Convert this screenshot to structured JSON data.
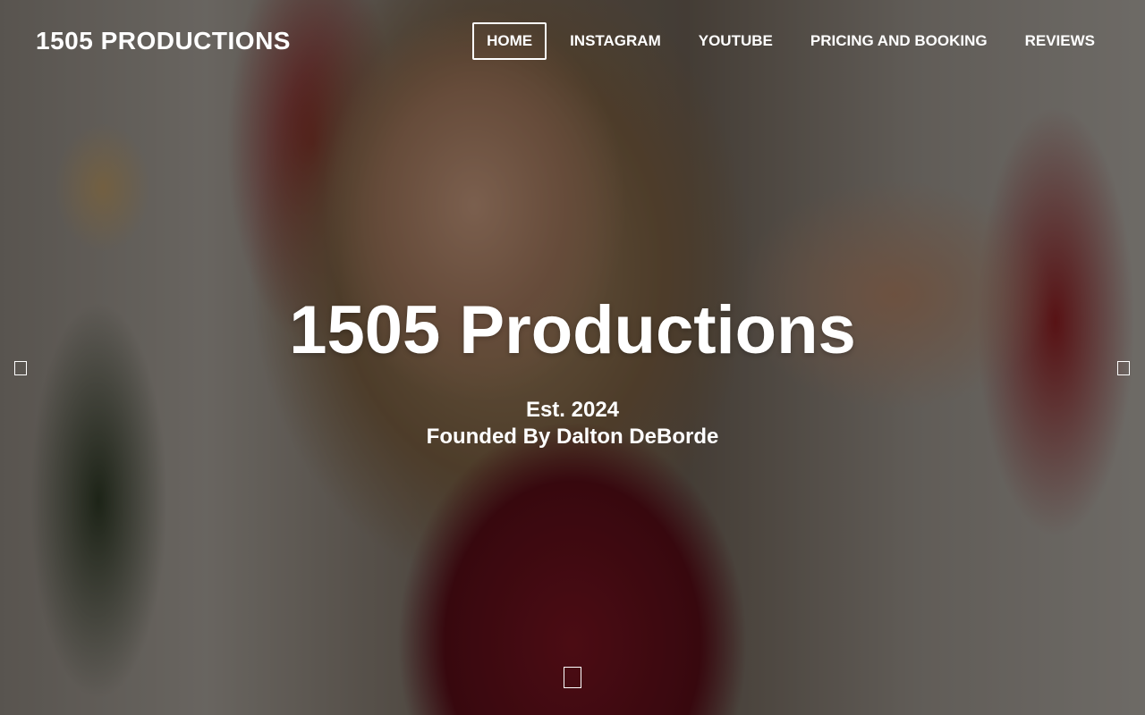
{
  "header": {
    "brand": "1505 PRODUCTIONS",
    "nav": [
      {
        "label": "HOME",
        "active": true
      },
      {
        "label": "INSTAGRAM",
        "active": false
      },
      {
        "label": "YOUTUBE",
        "active": false
      },
      {
        "label": "PRICING AND BOOKING",
        "active": false
      },
      {
        "label": "REVIEWS",
        "active": false
      }
    ]
  },
  "hero": {
    "title": "1505 Productions",
    "subtitle_line1": "Est. 2024",
    "subtitle_line2": "Founded By Dalton DeBorde"
  },
  "icons": {
    "prev": "arrow-left-icon",
    "next": "arrow-right-icon",
    "scroll": "scroll-down-icon"
  },
  "colors": {
    "text": "#ffffff",
    "overlay": "rgba(0,0,0,0.38)"
  }
}
